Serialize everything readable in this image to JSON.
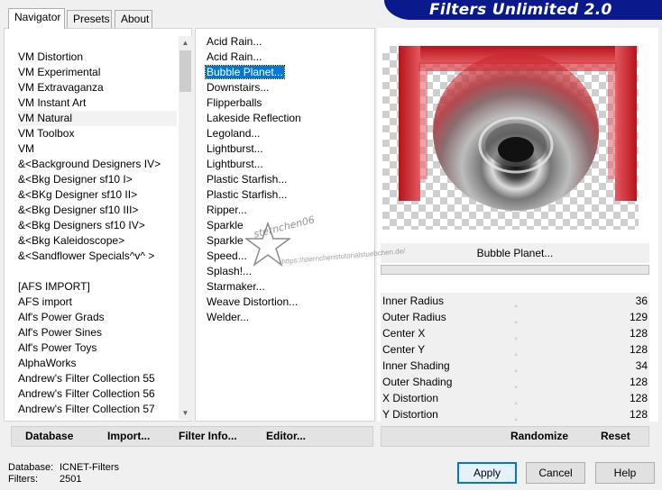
{
  "app_title": "Filters Unlimited 2.0",
  "tabs": [
    {
      "label": "Navigator",
      "active": true
    },
    {
      "label": "Presets",
      "active": false
    },
    {
      "label": "About",
      "active": false
    }
  ],
  "categories": {
    "group1": [
      "VM Distortion",
      "VM Experimental",
      "VM Extravaganza",
      "VM Instant Art",
      "VM Natural",
      "VM Toolbox",
      "VM",
      "&<Background Designers IV>",
      "&<Bkg Designer sf10 I>",
      "&<BKg Designer sf10 II>",
      "&<Bkg Designer sf10 III>",
      "&<Bkg Designers sf10 IV>",
      "&<Bkg Kaleidoscope>",
      "&<Sandflower Specials^v^ >"
    ],
    "group2": [
      "[AFS IMPORT]",
      "AFS import",
      "Alf's Power Grads",
      "Alf's Power Sines",
      "Alf's Power Toys",
      "AlphaWorks",
      "Andrew's Filter Collection 55",
      "Andrew's Filter Collection 56",
      "Andrew's Filter Collection 57"
    ],
    "selected": "VM Natural"
  },
  "filters": {
    "items": [
      "Acid Rain...",
      "Acid Rain...",
      "Bubble Planet...",
      "Downstairs...",
      "Flipperballs",
      "Lakeside Reflection",
      "Legoland...",
      "Lightburst...",
      "Lightburst...",
      "Plastic Starfish...",
      "Plastic Starfish...",
      "Ripper...",
      "Sparkle",
      "Sparkle",
      "Speed...",
      "Splash!...",
      "Starmaker...",
      "Weave Distortion...",
      "Welder..."
    ],
    "selected_index": 2
  },
  "preview": {
    "filter_name": "Bubble Planet...",
    "colors": {
      "red": "#c41a22",
      "dark_red": "#7a0d12",
      "gray": "#9a9a9a"
    }
  },
  "params": [
    {
      "name": "Inner Radius",
      "value": "36"
    },
    {
      "name": "Outer Radius",
      "value": "129"
    },
    {
      "name": "Center X",
      "value": "128"
    },
    {
      "name": "Center Y",
      "value": "128"
    },
    {
      "name": "Inner Shading",
      "value": "34"
    },
    {
      "name": "Outer Shading",
      "value": "128"
    },
    {
      "name": "X Distortion",
      "value": "128"
    },
    {
      "name": "Y Distortion",
      "value": "128"
    }
  ],
  "strip_left": {
    "database": "Database",
    "import": "Import...",
    "filter_info": "Filter Info...",
    "editor": "Editor..."
  },
  "strip_right": {
    "randomize": "Randomize",
    "reset": "Reset"
  },
  "footer": {
    "database_label": "Database:",
    "database_value": "ICNET-Filters",
    "filters_label": "Filters:",
    "filters_value": "2501"
  },
  "dialog_buttons": {
    "apply": "Apply",
    "cancel": "Cancel",
    "help": "Help"
  },
  "watermark": {
    "name": "sternchen06",
    "url": "https://sternchenstutorialstuebchen.de/"
  }
}
